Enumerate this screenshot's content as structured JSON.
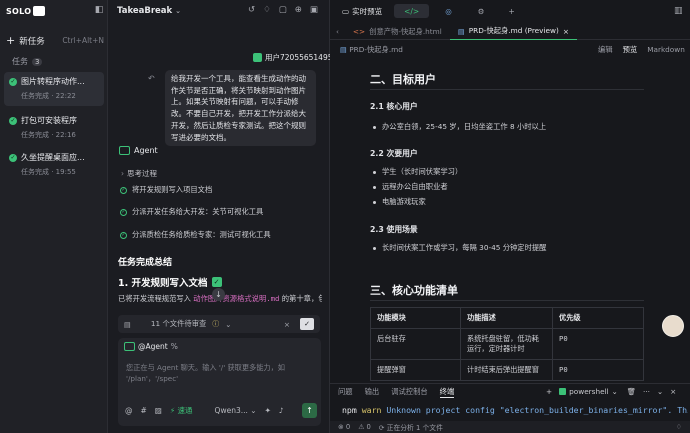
{
  "app": {
    "logo_text": "SOLO"
  },
  "sidebar": {
    "new_task": "新任务",
    "new_task_shortcut": "Ctrl+Alt+N",
    "tasks_label": "任务",
    "tasks_count": "3",
    "tasks": [
      {
        "title": "图片转程序动作...",
        "status": "任务完成 · 22:22"
      },
      {
        "title": "打包可安装程序",
        "status": "任务完成 · 22:16"
      },
      {
        "title": "久坐提醒桌面应...",
        "status": "任务完成 · 19:55"
      }
    ]
  },
  "chat": {
    "title": "TakeaBreak",
    "user_name": "用户72055651495",
    "message": "给我开发一个工具，能查看生成动作的动作关节是否正确，将关节映射到动作图片上。如果关节映射有问题，可以手动修改。不要自己开发，把开发工作分派给大开发，然后让质检专家测试。把这个规则写进必要的文档。",
    "agent_label": "Agent",
    "think_label": "思考过程",
    "steps": [
      "将开发规则写入项目文档",
      "分派开发任务给大开发：关节可视化工具",
      "分派质检任务给质检专家：测试可视化工具"
    ],
    "summary_title": "任务完成总结",
    "section_title": "1. 开发规则写入文档",
    "para_prefix": "已将开发流程规范写入 ",
    "para_code": "动作图片资源格式说明.md",
    "para_suffix": " 的第十章，包",
    "files_text": "11 个文件待审查",
    "input_tag": "@Agent",
    "input_placeholder": "您正在与 Agent 聊天。输入 '/' 获取更多能力，如 '/plan'，'/spec'",
    "speed_label": "速通",
    "model_label": "Qwen3..."
  },
  "right": {
    "top_tabs": [
      {
        "label": "实时预览"
      },
      {
        "label": "</>"
      }
    ],
    "file_tabs": [
      {
        "label": "创意产物-快起身.html"
      },
      {
        "label": "PRD-快起身.md (Preview)"
      }
    ],
    "breadcrumb": "PRD-快起身.md",
    "modes": [
      "编辑",
      "预览",
      "Markdown"
    ],
    "doc": {
      "h_target": "二、目标用户",
      "h_core": "2.1 核心用户",
      "li_core": "办公室白领，25-45 岁，日均坐姿工作 8 小时以上",
      "h_secondary": "2.2 次要用户",
      "li_secondary": [
        "学生（长时间伏案学习）",
        "远程办公自由职业者",
        "电脑游戏玩家"
      ],
      "h_scene": "2.3 使用场景",
      "li_scene": "长时间伏案工作或学习，每隔 30-45 分钟定时提醒",
      "h_features": "三、核心功能清单",
      "table": {
        "headers": [
          "功能模块",
          "功能描述",
          "优先级"
        ],
        "rows": [
          [
            "后台驻存",
            "系统托盘驻留，低功耗运行，定时器计时",
            "P0"
          ],
          [
            "提醒弹窗",
            "计时结束后弹出提醒窗",
            "P0"
          ]
        ]
      }
    },
    "terminal": {
      "tabs": [
        "问题",
        "输出",
        "调试控制台",
        "终端"
      ],
      "shell": "powershell",
      "prefix": "npm ",
      "warn": "warn",
      "message": " Unknown project config \"electron_builder_binaries_mirror\". This will"
    },
    "status": {
      "errors": "0",
      "warnings": "0",
      "analyzing": "正在分析 1 个文件"
    }
  }
}
